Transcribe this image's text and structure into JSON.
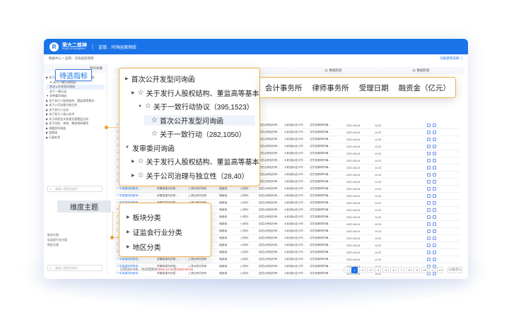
{
  "app": {
    "brand_cn": "荣大二郎神",
    "brand_en": "Rong Da Erlangshen",
    "separator": "|",
    "module_title": "监管、问询函案例库"
  },
  "breadcrumb": {
    "text": "数据中心 > 监管、问询函案例库",
    "right_link": "功能使用说明 ⓘ"
  },
  "sidebar": {
    "head": "我的收藏",
    "tree": [
      "▶ 关于发行人股权结构、董监高等基本…",
      "▼ 关于一致行动协议",
      "  首次公开发型问询函",
      "  关于一致行动",
      "▼ 发审委问询函",
      "▶ 关于发行人股权结构、董监高等基本…",
      "▶ 关于公司治理与独立性",
      "▶ 关于发行人业务",
      "▶ 关于发行人核心技术",
      "▶ 关于研发会计处理及管理层分析",
      "▶ 关于风险、其他、需说明的事项",
      "▶ 再融资问询函",
      "▶ 监管函",
      "▶ 行政处罚"
    ],
    "search_placeholder": "请输入搜索关键词",
    "dim_items": [
      "板块分类",
      "证监会行业分类",
      "地区分类"
    ],
    "search2_placeholder": "请输入搜索关键词"
  },
  "tabs": [
    {
      "icon": "▤",
      "label": "数据摘要"
    },
    {
      "icon": "🔍",
      "label": "数据检索"
    },
    {
      "icon": "▤",
      "label": "数据检索"
    },
    {
      "icon": "▤",
      "label": "数据检索"
    }
  ],
  "table": {
    "rows": [
      [
        "广东某某科技股份…",
        "安徽某某科技股…",
        "上海证券交易所",
        "福建省",
        "已询问",
        "国信证券股份有…",
        "天职国际会计师…",
        "北京国枫律师事…",
        "2020-08-04",
        "14.32"
      ],
      [
        "广东某某科技股份…",
        "安徽某某科技股…",
        "上海证券交易所",
        "福建省",
        "已询问",
        "国信证券股份有…",
        "天职国际会计师…",
        "北京国枫律师事…",
        "2020-08-04",
        "14.32"
      ],
      [
        "广东某某科技股份…",
        "安徽某某科技股…",
        "上海证券交易所",
        "福建省",
        "已询问",
        "国信证券股份有…",
        "天职国际会计师…",
        "北京国枫律师事…",
        "2020-08-04",
        "14.32"
      ],
      [
        "广东某某科技股份…",
        "安徽某某科技股…",
        "上海证券交易所",
        "福建省",
        "已询问",
        "国信证券股份有…",
        "天职国际会计师…",
        "北京国枫律师事…",
        "2020-08-04",
        "14.32"
      ],
      [
        "广东某某科技股份…",
        "安徽某某科技股…",
        "上海证券交易所",
        "福建省",
        "已询问",
        "国信证券股份有…",
        "天职国际会计师…",
        "北京国枫律师事…",
        "2020-08-04",
        "14.32"
      ],
      [
        "广东某某科技股份…",
        "安徽某某科技股…",
        "上海证券交易所",
        "福建省",
        "已询问",
        "国信证券股份有…",
        "天职国际会计师…",
        "北京国枫律师事…",
        "2020-08-04",
        "14.32"
      ],
      [
        "广东某某科技股份…",
        "安徽某某科技股…",
        "上海证券交易所",
        "福建省",
        "已询问",
        "国信证券股份有…",
        "天职国际会计师…",
        "北京国枫律师事…",
        "2020-08-04",
        "14.32"
      ],
      [
        "广东某某科技股份…",
        "安徽某某科技股…",
        "上海证券交易所",
        "福建省",
        "已询问",
        "国信证券股份有…",
        "天职国际会计师…",
        "北京国枫律师事…",
        "2020-08-04",
        "14.32"
      ],
      [
        "广东某某科技股份…",
        "安徽某某科技股…",
        "上海证券交易所",
        "福建省",
        "已询问",
        "国信证券股份有…",
        "天职国际会计师…",
        "北京国枫律师事…",
        "2020-08-04",
        "14.32"
      ],
      [
        "广东某某科技股份…",
        "安徽某某科技股…",
        "上海证券交易所",
        "福建省",
        "已询问",
        "国信证券股份有…",
        "天职国际会计师…",
        "北京国枫律师事…",
        "2020-08-04",
        "14.32"
      ],
      [
        "广东某某科技股份…",
        "安徽某某科技股…",
        "上海证券交易所",
        "福建省",
        "已询问",
        "国信证券股份有…",
        "天职国际会计师…",
        "北京国枫律师事…",
        "2020-08-04",
        "14.32"
      ],
      [
        "广东某某科技股份…",
        "安徽某某科技股…",
        "上海证券交易所",
        "福建省",
        "已询问",
        "国信证券股份有…",
        "天职国际会计师…",
        "北京国枫律师事…",
        "2020-08-04",
        "14.32"
      ],
      [
        "广东某某科技股份…",
        "安徽某某科技股…",
        "上海证券交易所",
        "福建省",
        "已询问",
        "国信证券股份有…",
        "天职国际会计师…",
        "北京国枫律师事…",
        "2020-08-04",
        "14.32"
      ],
      [
        "广东某某科技股份…",
        "安徽某某科技股…",
        "上海证券交易所",
        "福建省",
        "已询问",
        "国信证券股份有…",
        "天职国际会计师…",
        "北京国枫律师事…",
        "2020-08-04",
        "14.32"
      ],
      [
        "广东某某科技股份…",
        "安徽某某科技股…",
        "上海证券交易所",
        "福建省",
        "已询问",
        "国信证券股份有…",
        "天职国际会计师…",
        "北京国枫律师事…",
        "2020-08-04",
        "14.32"
      ],
      [
        "广东某某科技股份…",
        "安徽某某科技股…",
        "上海证券交易所",
        "福建省",
        "已询问",
        "国信证券股份有…",
        "天职国际会计师…",
        "北京国枫律师事…",
        "2020-08-04",
        "14.32"
      ],
      [
        "广东某某科技股份…",
        "安徽某某科技股…",
        "上海证券交易所",
        "福建省",
        "已询问",
        "国信证券股份有…",
        "天职国际会计师…",
        "北京国枫律师事…",
        "2020-08-04",
        "14.32"
      ],
      [
        "广东某某科技股份…",
        "安徽某某科技股…",
        "上海证券交易所",
        "福建省",
        "已询问",
        "国信证券股份有…",
        "天职国际会计师…",
        "北京国枫律师事…",
        "2020-08-04",
        "14.32"
      ],
      [
        "广东某某科技股份…",
        "安徽某某科技股…",
        "上海证券交易所",
        "福建省",
        "已询问",
        "国信证券股份有…",
        "天职国际会计师…",
        "北京国枫律师事…",
        "2020-08-04",
        "14.32"
      ],
      [
        "广东某某科技股份…",
        "安徽某某科技股…",
        "上海证券交易所",
        "福建省",
        "已询问",
        "国信证券股份有…",
        "天职国际会计师…",
        "北京国枫律师事…",
        "2020-08-04",
        "14.32"
      ],
      [
        "广东某某科技股份…",
        "安徽某某科技股…",
        "上海证券交易所",
        "福建省",
        "已询问",
        "国信证券股份有…",
        "天职国际会计师…",
        "北京国枫律师事…",
        "2020-08-04",
        "14.32"
      ],
      [
        "广东某某科技股份…",
        "安徽某某科技股…",
        "上海证券交易所",
        "福建省",
        "已询问",
        "国信证券股份有…",
        "天职国际会计师…",
        "北京国枫律师事…",
        "2020-08-04",
        "14.32"
      ]
    ]
  },
  "footer": {
    "prefix": "已筛选875条，时间范围为",
    "date_from": "2019-12-31",
    "mid": "至",
    "date_to": "2020-06-06",
    "pages": [
      "<",
      "1",
      "2",
      "3",
      "4",
      "5",
      "6",
      "7",
      "8",
      "9",
      "10",
      ">",
      ">>"
    ],
    "active_page": "1",
    "page_size": "20条/页 ▾"
  },
  "callouts": {
    "filter_label": "待选指标",
    "dimension_label": "维度主题",
    "popup_tree": [
      {
        "indent": 0,
        "arrow": "▶",
        "star": false,
        "text": "首次公开发型问询函"
      },
      {
        "indent": 1,
        "arrow": "▶",
        "star": true,
        "text": "关于发行人股权结构、董监高等基本"
      },
      {
        "indent": 2,
        "arrow": "▼",
        "star": true,
        "text": "关于一致行动协议（395,1523）"
      },
      {
        "indent": 3,
        "arrow": "",
        "star": true,
        "text": "首次公开发型问询函",
        "highlight": true
      },
      {
        "indent": 3,
        "arrow": "",
        "star": true,
        "text": "关于一致行动（282,1050）"
      },
      {
        "indent": 0,
        "arrow": "▼",
        "star": false,
        "text": "发审委问询函"
      },
      {
        "indent": 1,
        "arrow": "▶",
        "star": true,
        "text": "关于发行人股权结构、董监高等基本"
      },
      {
        "indent": 1,
        "arrow": "▶",
        "star": true,
        "text": "关于公司治理与独立性（28,40）"
      }
    ],
    "dimension_items": [
      "板块分类",
      "证监会行业分类",
      "地区分类"
    ],
    "column_headers": [
      "会计事务所",
      "律师事务所",
      "受理日期",
      "融资金（亿元）"
    ]
  }
}
